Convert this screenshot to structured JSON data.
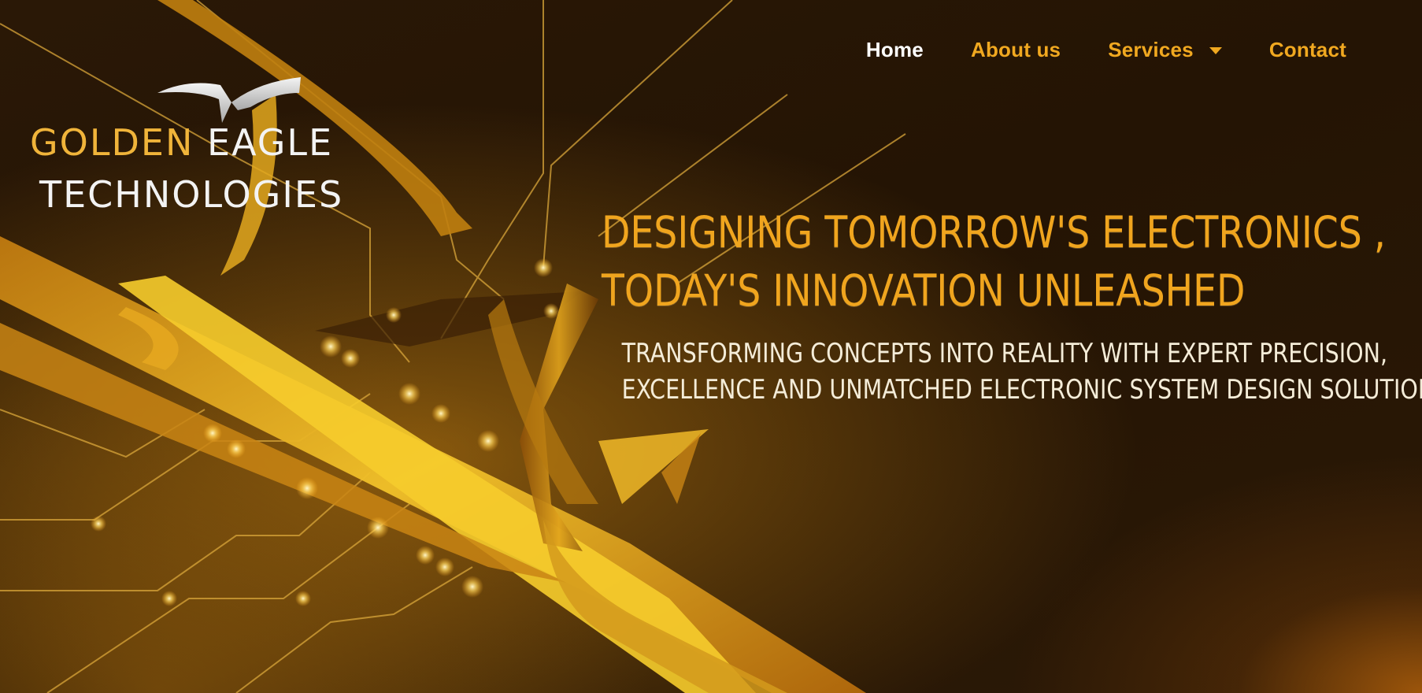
{
  "nav": {
    "items": [
      {
        "label": "Home",
        "active": true
      },
      {
        "label": "About us",
        "active": false
      },
      {
        "label": "Services",
        "active": false,
        "has_dropdown": true
      },
      {
        "label": "Contact",
        "active": false
      }
    ]
  },
  "logo": {
    "word_golden": "GOLDEN",
    "word_eagle": "EAGLE",
    "word_technologies": "TECHNOLOGIES",
    "icon": "eagle-wings-icon"
  },
  "hero": {
    "headline_line1": "DESIGNING TOMORROW'S  ELECTRONICS ,",
    "headline_line2": "TODAY'S INNOVATION UNLEASHED",
    "subline_line1": "TRANSFORMING CONCEPTS INTO REALITY WITH EXPERT PRECISION,",
    "subline_line2": "EXCELLENCE AND UNMATCHED ELECTRONIC SYSTEM DESIGN SOLUTIONS"
  },
  "colors": {
    "background": "#241505",
    "accent_gold": "#f0a820",
    "text_white": "#ffffff",
    "subline_text": "#f4ecd8"
  }
}
